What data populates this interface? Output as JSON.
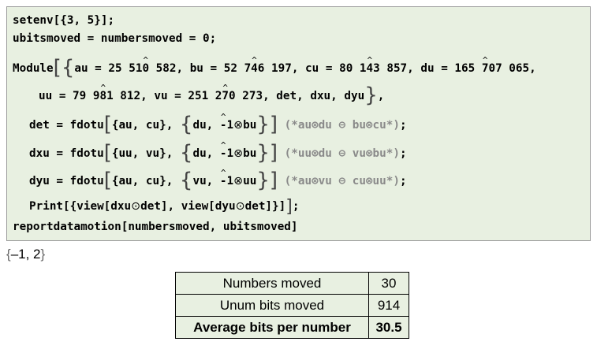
{
  "input": {
    "l1": "setenv[{3, 5}];",
    "l2": "ubitsmoved = numbersmoved = 0;",
    "l3_module": "Module",
    "l3_au": "au = 25 51",
    "l3_au_hat": "0",
    "l3_au_end": " 582, ",
    "l3_bu": "bu = 52 7",
    "l3_bu_hat": "4",
    "l3_bu_end": "6 197, ",
    "l3_cu": "cu = 80 1",
    "l3_cu_hat": "4",
    "l3_cu_end": "3 857, ",
    "l3_du": "du = 165 ",
    "l3_du_hat": "7",
    "l3_du_end": "07 065,",
    "l4_uu": "uu = 79 9",
    "l4_uu_hat": "8",
    "l4_uu_end": "1 812, ",
    "l4_vu": "vu = 251 2",
    "l4_vu_hat": "7",
    "l4_vu_end": "0 273, ",
    "l4_rest": "det, dxu, dyu",
    "l5_a": "det = fdotu",
    "l5_b": "{au, cu}, ",
    "l5_c": "du, ",
    "l5_neg": "-",
    "l5_one": "1",
    "l5_otimes": "⊗",
    "l5_d": "bu",
    "l5_comment": "(*au⊗du ⊖ bu⊗cu*)",
    "l6_a": "dxu = fdotu",
    "l6_b": "{uu, vu}, ",
    "l6_c": "du, ",
    "l6_d": "bu",
    "l6_comment": "(*uu⊗du ⊖ vu⊗bu*)",
    "l7_a": "dyu = fdotu",
    "l7_b": "{au, cu}, ",
    "l7_c": "vu, ",
    "l7_d": "uu",
    "l7_comment": "(*au⊗vu ⊖ cu⊗uu*)",
    "l8_a": "Print[{view[dxu",
    "l8_odot": "⊙",
    "l8_b": "det], view[dyu",
    "l8_c": "det]}]",
    "l9": "reportdatamotion[numbersmoved, ubitsmoved]"
  },
  "output": {
    "open": "{",
    "value": "–1, 2",
    "close": "}"
  },
  "table": {
    "rows": [
      {
        "label": "Numbers moved",
        "value": "30"
      },
      {
        "label": "Unum bits moved",
        "value": "914"
      },
      {
        "label": "Average bits per number",
        "value": "30.5"
      }
    ]
  }
}
